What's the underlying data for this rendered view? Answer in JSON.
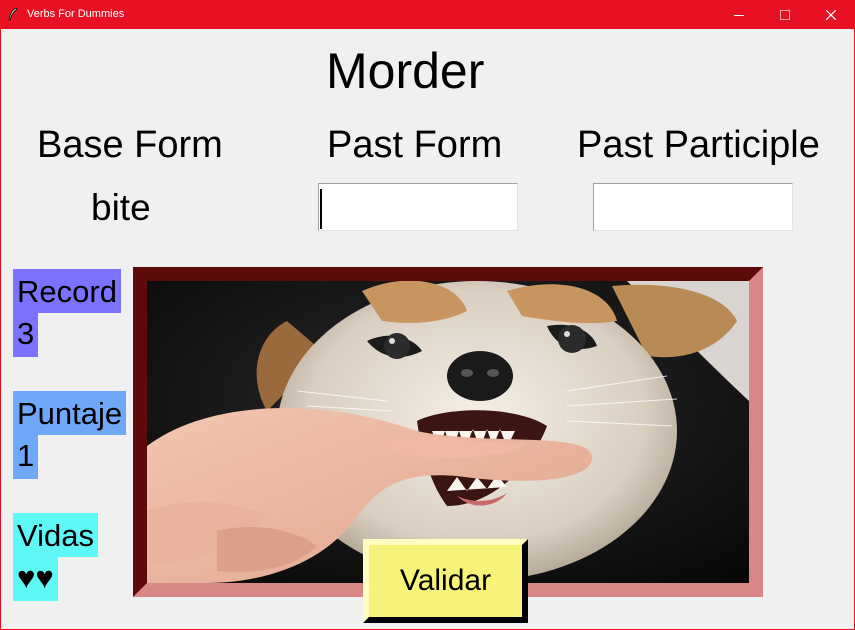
{
  "window": {
    "title": "Verbs For Dummies",
    "controls": {
      "minimize": "minimize-icon",
      "maximize": "maximize-icon",
      "close": "close-icon"
    },
    "accent_color": "#e81123"
  },
  "game": {
    "spanish_word": "Morder",
    "headers": {
      "base": "Base Form",
      "past": "Past Form",
      "participle": "Past Participle"
    },
    "base_value": "bite",
    "past_input_value": "",
    "participle_input_value": ""
  },
  "stats": {
    "record": {
      "label": "Record",
      "value": "3",
      "color": "#7b73ff"
    },
    "score": {
      "label": "Puntaje",
      "value": "1",
      "color": "#6fa8f8"
    },
    "lives": {
      "label": "Vidas",
      "value": "♥♥",
      "color": "#5ef8f6"
    }
  },
  "image": {
    "subject": "puppy biting a finger",
    "frame_colors": [
      "#5c0a0a",
      "#d88686"
    ]
  },
  "validate_button": {
    "label": "Validar",
    "color": "#f7f27a"
  }
}
